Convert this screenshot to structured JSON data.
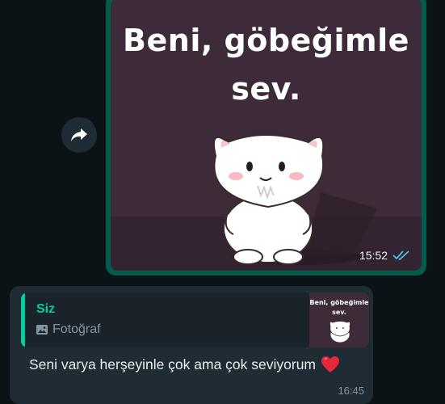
{
  "image_message": {
    "sticker_line1": "Beni, göbeğimle",
    "sticker_line2": "sev.",
    "time": "15:52",
    "status_icon": "double-check-read-icon",
    "status_color": "#53bdeb"
  },
  "forward_button": {
    "icon": "forward-arrow-icon"
  },
  "reply_message": {
    "quoted_author": "Siz",
    "quoted_type_icon": "photo-icon",
    "quoted_type_label": "Fotoğraf",
    "thumb_line1": "Beni, göbeğimle",
    "thumb_line2": "sev.",
    "text": "Seni varya herşeyinle çok ama çok seviyorum",
    "emoji_icon": "red-heart-icon",
    "time": "16:45"
  },
  "colors": {
    "background": "#0c1317",
    "outgoing_bubble": "#005c4b",
    "incoming_bubble": "#202c33",
    "accent": "#06cf9c",
    "sticker_bg": "#3e2b39"
  }
}
